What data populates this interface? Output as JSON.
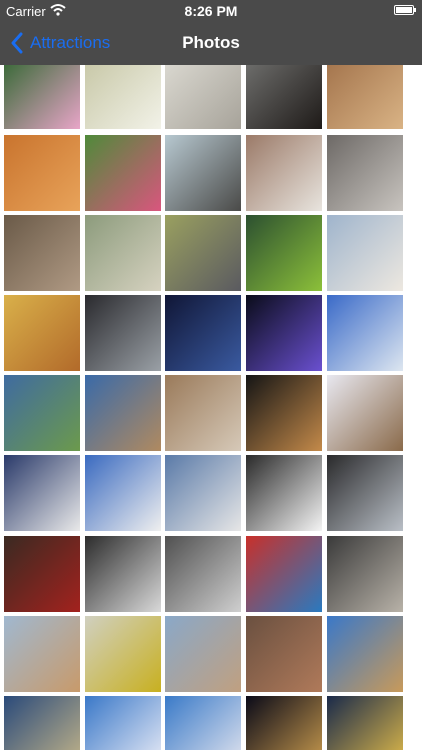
{
  "status": {
    "carrier": "Carrier",
    "time": "8:26 PM",
    "wifi_icon": "wifi-icon",
    "battery_level": 1.0
  },
  "nav": {
    "back_label": "Attractions",
    "title": "Photos",
    "back_icon": "chevron-left-icon"
  },
  "photos": [
    [
      "#3d6b3b",
      "#e8a5c8"
    ],
    [
      "#c9c9a9",
      "#f2f2e8"
    ],
    [
      "#d9d7cf",
      "#a7a39a"
    ],
    [
      "#6c6c6a",
      "#1e1a18"
    ],
    [
      "#a5764e",
      "#d9b385"
    ],
    [
      "#c9742e",
      "#e8a35a"
    ],
    [
      "#4f8a3a",
      "#d9567e"
    ],
    [
      "#b7c8d0",
      "#4a4a48"
    ],
    [
      "#9b7a68",
      "#e8e4de"
    ],
    [
      "#6d6966",
      "#c8c4bf"
    ],
    [
      "#6a5a48",
      "#b09a84"
    ],
    [
      "#8c9b7c",
      "#d6d2c0"
    ],
    [
      "#9aa060",
      "#5a5a60"
    ],
    [
      "#2c5030",
      "#8cc03a"
    ],
    [
      "#9fb4cc",
      "#ede8e0"
    ],
    [
      "#d9b04a",
      "#b26a2a"
    ],
    [
      "#2a2a2e",
      "#9aa0a6"
    ],
    [
      "#101636",
      "#3a5aa0"
    ],
    [
      "#0a0c1a",
      "#6a50d0"
    ],
    [
      "#3a6ac8",
      "#dde6f0"
    ],
    [
      "#3f6ba0",
      "#6c9a4c"
    ],
    [
      "#3a6aa8",
      "#b08a60"
    ],
    [
      "#9a7a5a",
      "#d6c9b8"
    ],
    [
      "#151515",
      "#c48a4a"
    ],
    [
      "#e8e8f0",
      "#8a6a4a"
    ],
    [
      "#2a3a6a",
      "#e9e9e9"
    ],
    [
      "#3a6ac0",
      "#efefef"
    ],
    [
      "#5a7aa8",
      "#e6e6e6"
    ],
    [
      "#2a2a2a",
      "#f4f4f4"
    ],
    [
      "#2a2a2c",
      "#b9bfc6"
    ],
    [
      "#3a2a22",
      "#a3221e"
    ],
    [
      "#2c2c2c",
      "#d9d9d9"
    ],
    [
      "#505050",
      "#cfcfcf"
    ],
    [
      "#c8302a",
      "#2a7ac0"
    ],
    [
      "#3a3a3a",
      "#b8b2a8"
    ],
    [
      "#a0b8d0",
      "#c89a6a"
    ],
    [
      "#d0d0c0",
      "#c8b020"
    ],
    [
      "#8aa8c8",
      "#c0a080"
    ],
    [
      "#6a5040",
      "#b07a5a"
    ],
    [
      "#3a78c8",
      "#c89a5a"
    ],
    [
      "#2a4a7a",
      "#c8b88a"
    ],
    [
      "#3a78c8",
      "#f0f0f8"
    ],
    [
      "#3a7ac8",
      "#e8e8f0"
    ],
    [
      "#0a0a18",
      "#d0a050"
    ],
    [
      "#1a2a4a",
      "#e8c04a"
    ]
  ]
}
